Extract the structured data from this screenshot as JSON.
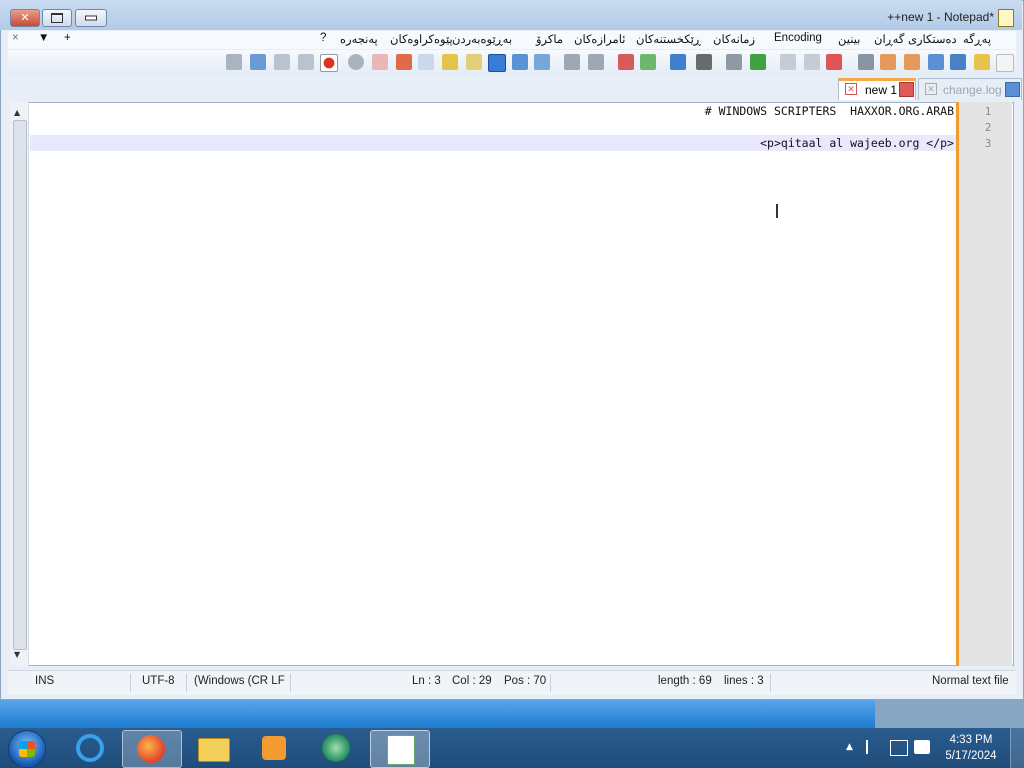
{
  "window": {
    "title": "++new 1 - Notepad*"
  },
  "menu": {
    "items": [
      "پەڕگە",
      "دەستکاری",
      "گەڕان",
      "بینین",
      "Encoding",
      "زمانەکان",
      "ڕێکخستنەکان",
      "ئامرازەکان",
      "ماکرۆ",
      "بەڕێوەبەردن",
      "پێوەکراوەکان",
      "پەنجەرە",
      "?"
    ],
    "left_controls": [
      "×",
      "▼",
      "+"
    ]
  },
  "tabs": [
    {
      "label": "new 1",
      "active": true
    },
    {
      "label": "change.log",
      "active": false
    }
  ],
  "editor": {
    "lines": [
      "# WINDOWS SCRIPTERS  HAXXOR.ORG.ARAB",
      "",
      "<p>qitaal al wajeeb.org </p>"
    ],
    "line_numbers": [
      "1",
      "2",
      "3"
    ]
  },
  "status": {
    "mode": "INS",
    "encoding": "UTF-8",
    "eol": "(Windows (CR LF",
    "ln": "Ln : 3",
    "col": "Col : 29",
    "pos": "Pos : 70",
    "length": "length : 69",
    "lines": "lines : 3",
    "filetype": "Normal text file"
  },
  "taskbar": {
    "time": "4:33 PM",
    "date": "5/17/2024"
  }
}
